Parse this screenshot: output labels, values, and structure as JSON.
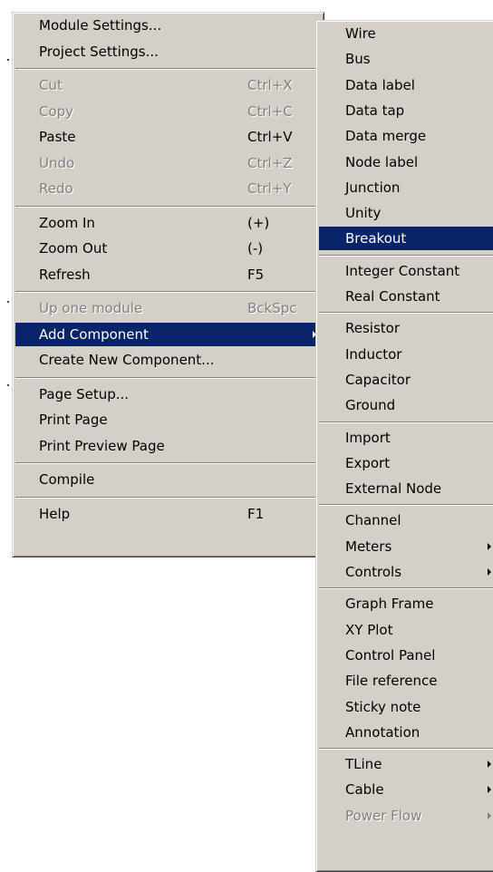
{
  "main_menu": {
    "groups": [
      [
        {
          "label": "Module Settings...",
          "shortcut": "",
          "disabled": false
        },
        {
          "label": "Project Settings...",
          "shortcut": "",
          "disabled": false
        }
      ],
      [
        {
          "label": "Cut",
          "shortcut": "Ctrl+X",
          "disabled": true
        },
        {
          "label": "Copy",
          "shortcut": "Ctrl+C",
          "disabled": true
        },
        {
          "label": "Paste",
          "shortcut": "Ctrl+V",
          "disabled": false
        },
        {
          "label": "Undo",
          "shortcut": "Ctrl+Z",
          "disabled": true
        },
        {
          "label": "Redo",
          "shortcut": "Ctrl+Y",
          "disabled": true
        }
      ],
      [
        {
          "label": "Zoom In",
          "shortcut": "(+)",
          "disabled": false
        },
        {
          "label": "Zoom Out",
          "shortcut": "(-)",
          "disabled": false
        },
        {
          "label": "Refresh",
          "shortcut": "F5",
          "disabled": false
        }
      ],
      [
        {
          "label": "Up one module",
          "shortcut": "BckSpc",
          "disabled": true
        },
        {
          "label": "Add Component",
          "shortcut": "",
          "disabled": false,
          "selected": true,
          "submenu": true
        },
        {
          "label": "Create New Component...",
          "shortcut": "",
          "disabled": false
        }
      ],
      [
        {
          "label": "Page Setup...",
          "shortcut": "",
          "disabled": false
        },
        {
          "label": "Print Page",
          "shortcut": "",
          "disabled": false
        },
        {
          "label": "Print Preview Page",
          "shortcut": "",
          "disabled": false
        }
      ],
      [
        {
          "label": "Compile",
          "shortcut": "",
          "disabled": false
        }
      ],
      [
        {
          "label": "Help",
          "shortcut": "F1",
          "disabled": false
        }
      ]
    ]
  },
  "sub_menu": {
    "groups": [
      [
        {
          "label": "Wire"
        },
        {
          "label": "Bus"
        },
        {
          "label": "Data label"
        },
        {
          "label": "Data tap"
        },
        {
          "label": "Data merge"
        },
        {
          "label": "Node label"
        },
        {
          "label": "Junction"
        },
        {
          "label": "Unity"
        },
        {
          "label": "Breakout",
          "selected": true
        }
      ],
      [
        {
          "label": "Integer Constant"
        },
        {
          "label": "Real Constant"
        }
      ],
      [
        {
          "label": "Resistor"
        },
        {
          "label": "Inductor"
        },
        {
          "label": "Capacitor"
        },
        {
          "label": "Ground"
        }
      ],
      [
        {
          "label": "Import"
        },
        {
          "label": "Export"
        },
        {
          "label": "External Node"
        }
      ],
      [
        {
          "label": "Channel"
        },
        {
          "label": "Meters",
          "submenu": true
        },
        {
          "label": "Controls",
          "submenu": true
        }
      ],
      [
        {
          "label": "Graph Frame"
        },
        {
          "label": "XY Plot"
        },
        {
          "label": "Control Panel"
        },
        {
          "label": "File reference"
        },
        {
          "label": "Sticky note"
        },
        {
          "label": "Annotation"
        }
      ],
      [
        {
          "label": "TLine",
          "submenu": true
        },
        {
          "label": "Cable",
          "submenu": true
        },
        {
          "label": "Power Flow",
          "submenu": true,
          "disabled": true
        }
      ]
    ]
  },
  "colors": {
    "menu_face": "#d4d0c8",
    "highlight": "#0a246a",
    "highlight_text": "#ffffff",
    "disabled_text": "#808080"
  }
}
